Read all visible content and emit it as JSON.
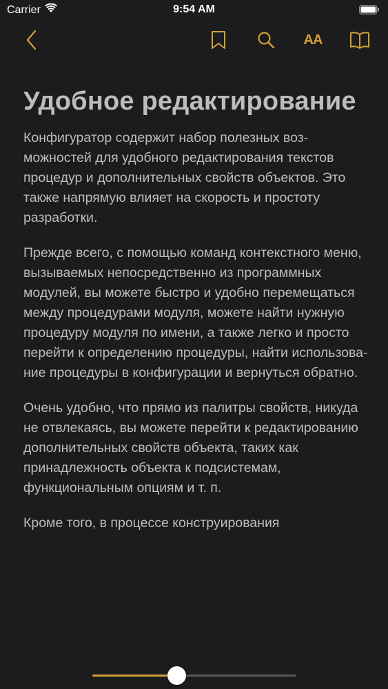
{
  "status_bar": {
    "carrier": "Carrier",
    "time": "9:54 AM",
    "wifi_icon": "wifi-icon",
    "battery_icon": "battery-icon"
  },
  "toolbar": {
    "back_icon": "chevron-left-icon",
    "bookmark_icon": "bookmark-icon",
    "search_icon": "search-icon",
    "text_size_label": "AA",
    "library_icon": "book-icon",
    "accent_color": "#d4a034"
  },
  "article": {
    "title": "Удобное редактирова­ние",
    "paragraphs": [
      "Конфигуратор содержит набор полезных воз­можностей для удобного редактирования тек­стов процедур и дополнительных свойств объ­ектов. Это также напрямую влияет на скорость и простоту разработки.",
      "Прежде всего, с помощью команд контекстно­го меню, вызываемых непосредственно из программных модулей, вы можете быстро и удобно перемещаться между процедурами модуля, можете найти нужную процедуру мо­дуля по имени, а также легко и просто перейти к определению процедуры, найти использова­ние процедуры в конфигурации и вернуться обратно.",
      "Очень удобно, что прямо из палитры свойств, никуда не отвлекаясь, вы можете перейти к ре­дактированию дополнительных свойств объек­та, таких как принадлежность объекта к подси­стемам, функциональным опциям и т. п.",
      "Кроме того, в процессе конструирования"
    ]
  },
  "page_slider": {
    "progress": 0.42
  }
}
